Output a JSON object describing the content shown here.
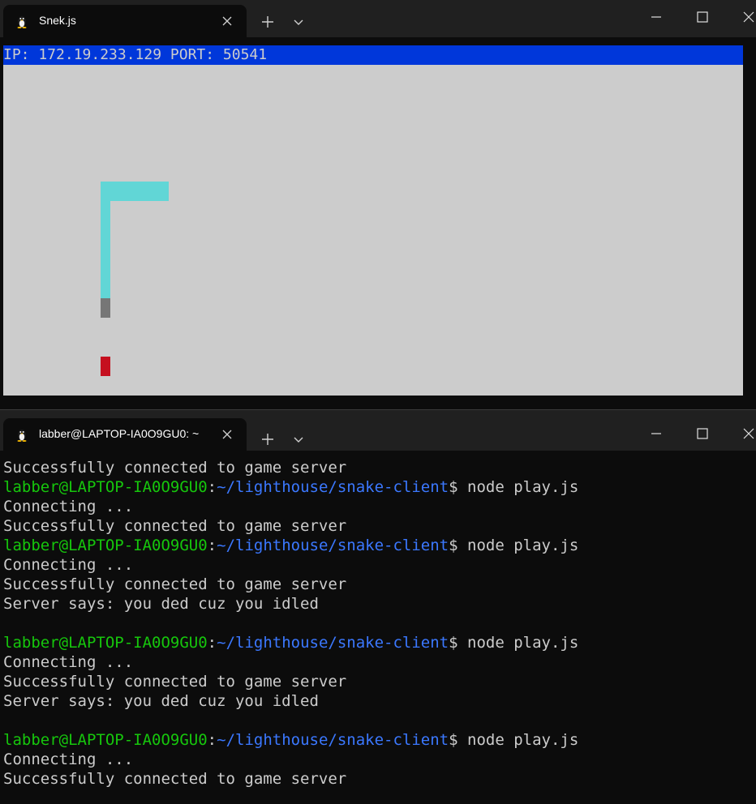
{
  "window_top": {
    "tab": {
      "title": "Snek.js"
    },
    "status_text": "IP: 172.19.233.129 PORT: 50541",
    "colors": {
      "snake": "#61d6d6",
      "snake_head": "#767676",
      "food": "#c50f1f",
      "status_bg": "#0037da",
      "board_bg": "#cccccc"
    }
  },
  "window_bottom": {
    "tab": {
      "title": "labber@LAPTOP-IA0O9GU0: ~"
    },
    "lines": [
      {
        "type": "output",
        "text": "Successfully connected to game server"
      },
      {
        "type": "prompt",
        "user": "labber@LAPTOP-IA0O9GU0",
        "sep": ":",
        "path": "~/lighthouse/snake-client",
        "dollar": "$ ",
        "cmd": "node play.js"
      },
      {
        "type": "output",
        "text": "Connecting ..."
      },
      {
        "type": "output",
        "text": "Successfully connected to game server"
      },
      {
        "type": "prompt",
        "user": "labber@LAPTOP-IA0O9GU0",
        "sep": ":",
        "path": "~/lighthouse/snake-client",
        "dollar": "$ ",
        "cmd": "node play.js"
      },
      {
        "type": "output",
        "text": "Connecting ..."
      },
      {
        "type": "output",
        "text": "Successfully connected to game server"
      },
      {
        "type": "output",
        "text": "Server says: you ded cuz you idled"
      },
      {
        "type": "output",
        "text": ""
      },
      {
        "type": "prompt",
        "user": "labber@LAPTOP-IA0O9GU0",
        "sep": ":",
        "path": "~/lighthouse/snake-client",
        "dollar": "$ ",
        "cmd": "node play.js"
      },
      {
        "type": "output",
        "text": "Connecting ..."
      },
      {
        "type": "output",
        "text": "Successfully connected to game server"
      },
      {
        "type": "output",
        "text": "Server says: you ded cuz you idled"
      },
      {
        "type": "output",
        "text": ""
      },
      {
        "type": "prompt",
        "user": "labber@LAPTOP-IA0O9GU0",
        "sep": ":",
        "path": "~/lighthouse/snake-client",
        "dollar": "$ ",
        "cmd": "node play.js"
      },
      {
        "type": "output",
        "text": "Connecting ..."
      },
      {
        "type": "output",
        "text": "Successfully connected to game server"
      }
    ]
  },
  "icons": {
    "tab": "linux-penguin-icon",
    "close": "close-icon",
    "new_tab": "plus-icon",
    "dropdown": "chevron-down-icon",
    "minimize": "minimize-icon",
    "maximize": "maximize-icon",
    "window_close": "window-close-icon"
  }
}
